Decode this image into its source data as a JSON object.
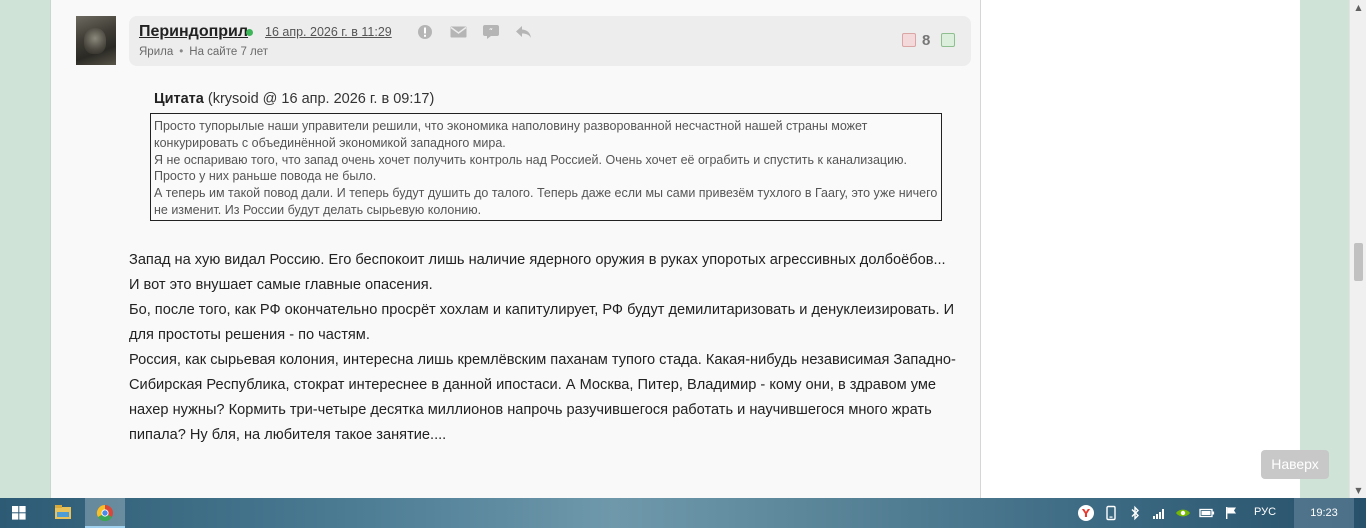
{
  "comment": {
    "username": "Периндоприл",
    "date": "16 апр. 2026 г. в 11:29",
    "faction": "Ярила",
    "tenure": "На сайте 7 лет",
    "rating": "8",
    "icons": {
      "report": "alert-icon",
      "message": "envelope-icon",
      "quote": "quote-icon",
      "reply": "reply-icon"
    }
  },
  "quote": {
    "label": "Цитата",
    "source": "(krysoid @ 16 апр. 2026 г. в 09:17)",
    "lines": [
      "Просто тупорылые наши управители решили, что экономика наполовину разворованной несчастной нашей страны может конкурировать с объединённой экономикой западного мира.",
      "Я не оспариваю того, что запад очень хочет получить контроль над Россией. Очень хочет её ограбить и спустить к канализацию. Просто у них раньше повода не было.",
      "А теперь им такой повод дали. И теперь будут душить до талого. Теперь даже если мы сами привезём тухлого в Гаагу, это уже ничего не изменит. Из России будут делать сырьевую колонию."
    ]
  },
  "body": {
    "paragraphs": [
      "Запад на хую видал Россию. Его беспокоит лишь наличие ядерного оружия в руках упоротых агрессивных долбоёбов...",
      "И вот это внушает самые главные опасения.",
      "Бо, после того, как РФ окончательно просрёт хохлам и капитулирует, РФ будут демилитаризовать и денуклеизировать. И для простоты решения - по частям.",
      "Россия, как сырьевая колония, интересна лишь кремлёвским паханам тупого стада. Какая-нибудь независимая Западно-Сибирская Республика, стократ интереснее в данной ипостаси. А Москва, Питер, Владимир - кому они, в здравом уме нахер нужны? Кормить три-четыре десятка миллионов напрочь разучившегося работать и научившегося много жрать пипала? Ну бля, на любителя такое занятие...."
    ]
  },
  "to_top_label": "Наверх",
  "taskbar": {
    "language": "РУС",
    "time": "19:23",
    "apps": [
      "windows-start-icon",
      "file-explorer-icon",
      "chrome-icon"
    ],
    "tray": [
      "yandex-icon",
      "phone-link-icon",
      "bluetooth-icon",
      "wifi-icon",
      "nvidia-icon",
      "battery-icon",
      "volume-icon",
      "flag-icon"
    ]
  },
  "colors": {
    "side_background": "#cfe3d6",
    "header_background": "#ededed",
    "online": "#3fb55a",
    "to_top_button": "#c8c8c8"
  }
}
